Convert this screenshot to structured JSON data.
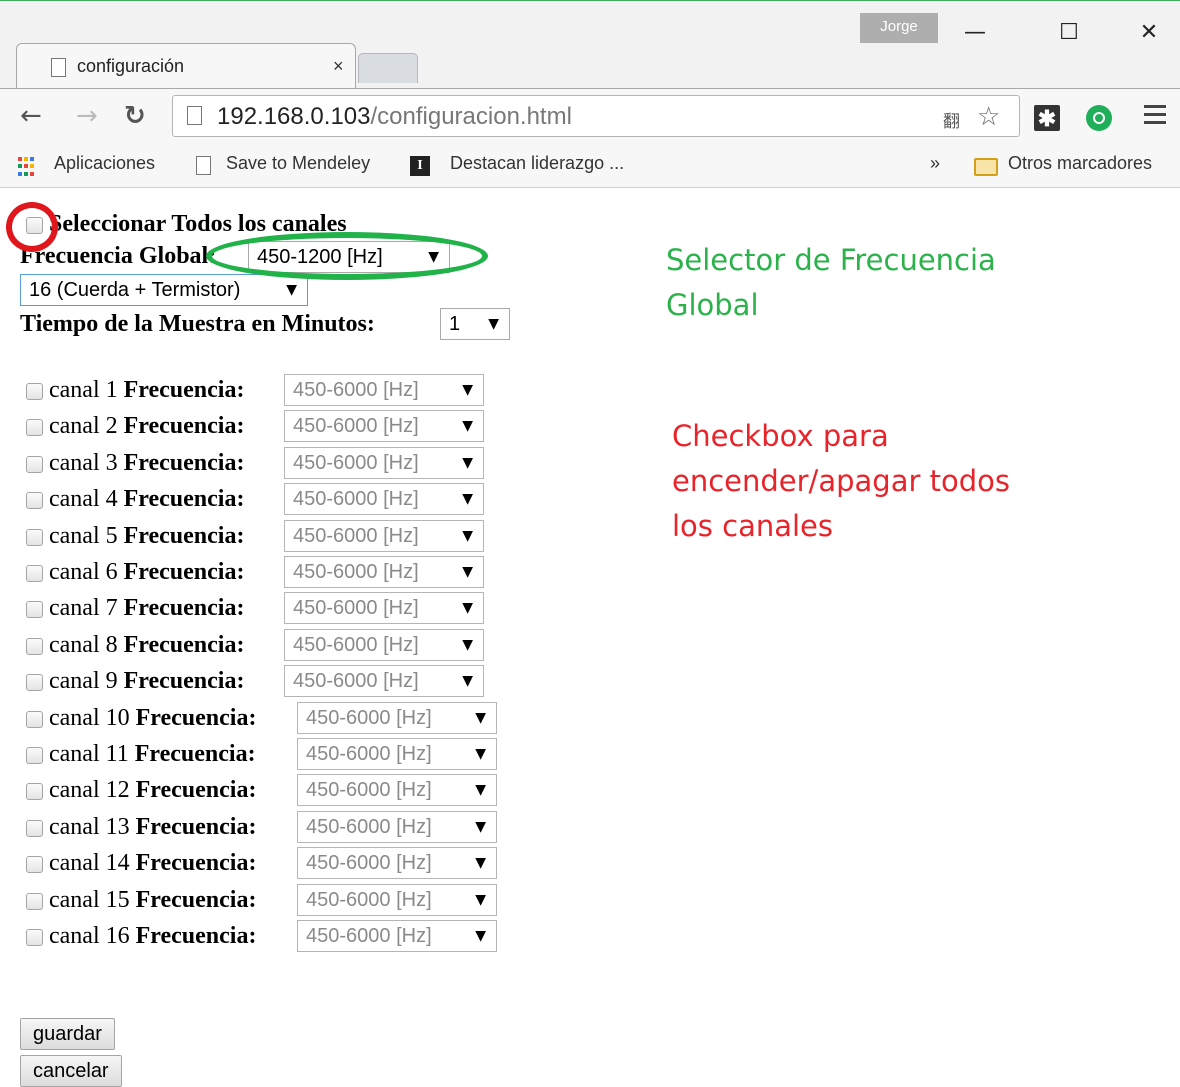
{
  "window": {
    "user_badge": "Jorge",
    "minimize": "—",
    "maximize": "☐",
    "close": "✕"
  },
  "tab": {
    "title": "configuración",
    "close": "×"
  },
  "toolbar": {
    "url_host": "192.168.0.103",
    "url_path": "/configuracion.html"
  },
  "bookmarks": {
    "items": [
      "Aplicaciones",
      "Save to Mendeley",
      "Destacan liderazgo ..."
    ],
    "overflow": "»",
    "other": "Otros marcadores"
  },
  "page": {
    "select_all_label": "Seleccionar Todos los canales",
    "global_freq_label": "Frecuencia Global:",
    "global_freq_value": "450-1200 [Hz]",
    "channels_mode_value": "16 (Cuerda + Termistor)",
    "sample_time_label": "Tiempo de la Muestra en Minutos:",
    "sample_time_value": "1",
    "channel_freq_label": "Frecuencia:",
    "channels": [
      {
        "label": "canal 1",
        "freq": "450-6000 [Hz]"
      },
      {
        "label": "canal 2",
        "freq": "450-6000 [Hz]"
      },
      {
        "label": "canal 3",
        "freq": "450-6000 [Hz]"
      },
      {
        "label": "canal 4",
        "freq": "450-6000 [Hz]"
      },
      {
        "label": "canal 5",
        "freq": "450-6000 [Hz]"
      },
      {
        "label": "canal 6",
        "freq": "450-6000 [Hz]"
      },
      {
        "label": "canal 7",
        "freq": "450-6000 [Hz]"
      },
      {
        "label": "canal 8",
        "freq": "450-6000 [Hz]"
      },
      {
        "label": "canal 9",
        "freq": "450-6000 [Hz]"
      },
      {
        "label": "canal 10",
        "freq": "450-6000 [Hz]"
      },
      {
        "label": "canal 11",
        "freq": "450-6000 [Hz]"
      },
      {
        "label": "canal 12",
        "freq": "450-6000 [Hz]"
      },
      {
        "label": "canal 13",
        "freq": "450-6000 [Hz]"
      },
      {
        "label": "canal 14",
        "freq": "450-6000 [Hz]"
      },
      {
        "label": "canal 15",
        "freq": "450-6000 [Hz]"
      },
      {
        "label": "canal 16",
        "freq": "450-6000 [Hz]"
      }
    ],
    "save_button": "guardar",
    "cancel_button": "cancelar"
  },
  "annotations": {
    "green_line1": "Selector de Frecuencia",
    "green_line2": "Global",
    "red_line1": "Checkbox para",
    "red_line2": "encender/apagar todos",
    "red_line3": "los canales"
  },
  "colors": {
    "annotation_green": "#2bb24a",
    "annotation_red": "#e8242b"
  }
}
